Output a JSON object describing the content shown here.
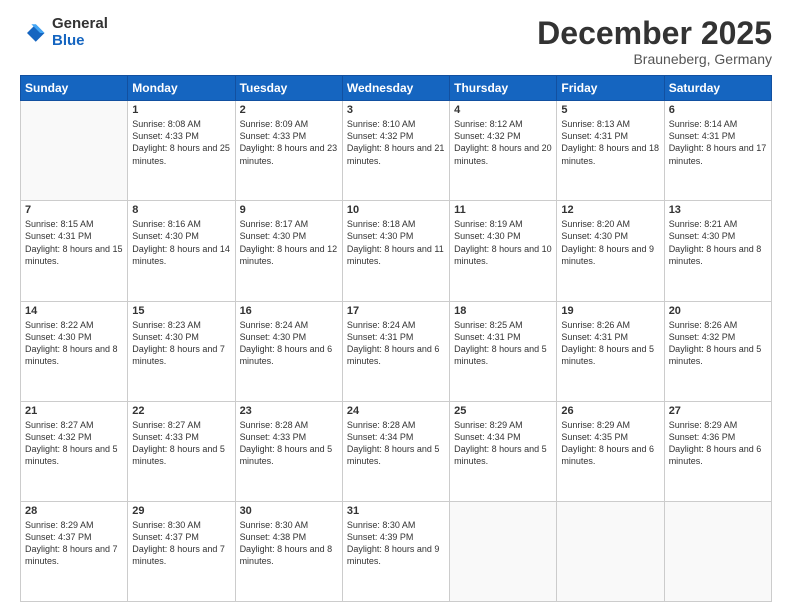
{
  "logo": {
    "general": "General",
    "blue": "Blue"
  },
  "header": {
    "month": "December 2025",
    "location": "Brauneberg, Germany"
  },
  "weekdays": [
    "Sunday",
    "Monday",
    "Tuesday",
    "Wednesday",
    "Thursday",
    "Friday",
    "Saturday"
  ],
  "weeks": [
    [
      {
        "day": "",
        "empty": true
      },
      {
        "day": "1",
        "sunrise": "Sunrise: 8:08 AM",
        "sunset": "Sunset: 4:33 PM",
        "daylight": "Daylight: 8 hours and 25 minutes."
      },
      {
        "day": "2",
        "sunrise": "Sunrise: 8:09 AM",
        "sunset": "Sunset: 4:33 PM",
        "daylight": "Daylight: 8 hours and 23 minutes."
      },
      {
        "day": "3",
        "sunrise": "Sunrise: 8:10 AM",
        "sunset": "Sunset: 4:32 PM",
        "daylight": "Daylight: 8 hours and 21 minutes."
      },
      {
        "day": "4",
        "sunrise": "Sunrise: 8:12 AM",
        "sunset": "Sunset: 4:32 PM",
        "daylight": "Daylight: 8 hours and 20 minutes."
      },
      {
        "day": "5",
        "sunrise": "Sunrise: 8:13 AM",
        "sunset": "Sunset: 4:31 PM",
        "daylight": "Daylight: 8 hours and 18 minutes."
      },
      {
        "day": "6",
        "sunrise": "Sunrise: 8:14 AM",
        "sunset": "Sunset: 4:31 PM",
        "daylight": "Daylight: 8 hours and 17 minutes."
      }
    ],
    [
      {
        "day": "7",
        "sunrise": "Sunrise: 8:15 AM",
        "sunset": "Sunset: 4:31 PM",
        "daylight": "Daylight: 8 hours and 15 minutes."
      },
      {
        "day": "8",
        "sunrise": "Sunrise: 8:16 AM",
        "sunset": "Sunset: 4:30 PM",
        "daylight": "Daylight: 8 hours and 14 minutes."
      },
      {
        "day": "9",
        "sunrise": "Sunrise: 8:17 AM",
        "sunset": "Sunset: 4:30 PM",
        "daylight": "Daylight: 8 hours and 12 minutes."
      },
      {
        "day": "10",
        "sunrise": "Sunrise: 8:18 AM",
        "sunset": "Sunset: 4:30 PM",
        "daylight": "Daylight: 8 hours and 11 minutes."
      },
      {
        "day": "11",
        "sunrise": "Sunrise: 8:19 AM",
        "sunset": "Sunset: 4:30 PM",
        "daylight": "Daylight: 8 hours and 10 minutes."
      },
      {
        "day": "12",
        "sunrise": "Sunrise: 8:20 AM",
        "sunset": "Sunset: 4:30 PM",
        "daylight": "Daylight: 8 hours and 9 minutes."
      },
      {
        "day": "13",
        "sunrise": "Sunrise: 8:21 AM",
        "sunset": "Sunset: 4:30 PM",
        "daylight": "Daylight: 8 hours and 8 minutes."
      }
    ],
    [
      {
        "day": "14",
        "sunrise": "Sunrise: 8:22 AM",
        "sunset": "Sunset: 4:30 PM",
        "daylight": "Daylight: 8 hours and 8 minutes."
      },
      {
        "day": "15",
        "sunrise": "Sunrise: 8:23 AM",
        "sunset": "Sunset: 4:30 PM",
        "daylight": "Daylight: 8 hours and 7 minutes."
      },
      {
        "day": "16",
        "sunrise": "Sunrise: 8:24 AM",
        "sunset": "Sunset: 4:30 PM",
        "daylight": "Daylight: 8 hours and 6 minutes."
      },
      {
        "day": "17",
        "sunrise": "Sunrise: 8:24 AM",
        "sunset": "Sunset: 4:31 PM",
        "daylight": "Daylight: 8 hours and 6 minutes."
      },
      {
        "day": "18",
        "sunrise": "Sunrise: 8:25 AM",
        "sunset": "Sunset: 4:31 PM",
        "daylight": "Daylight: 8 hours and 5 minutes."
      },
      {
        "day": "19",
        "sunrise": "Sunrise: 8:26 AM",
        "sunset": "Sunset: 4:31 PM",
        "daylight": "Daylight: 8 hours and 5 minutes."
      },
      {
        "day": "20",
        "sunrise": "Sunrise: 8:26 AM",
        "sunset": "Sunset: 4:32 PM",
        "daylight": "Daylight: 8 hours and 5 minutes."
      }
    ],
    [
      {
        "day": "21",
        "sunrise": "Sunrise: 8:27 AM",
        "sunset": "Sunset: 4:32 PM",
        "daylight": "Daylight: 8 hours and 5 minutes."
      },
      {
        "day": "22",
        "sunrise": "Sunrise: 8:27 AM",
        "sunset": "Sunset: 4:33 PM",
        "daylight": "Daylight: 8 hours and 5 minutes."
      },
      {
        "day": "23",
        "sunrise": "Sunrise: 8:28 AM",
        "sunset": "Sunset: 4:33 PM",
        "daylight": "Daylight: 8 hours and 5 minutes."
      },
      {
        "day": "24",
        "sunrise": "Sunrise: 8:28 AM",
        "sunset": "Sunset: 4:34 PM",
        "daylight": "Daylight: 8 hours and 5 minutes."
      },
      {
        "day": "25",
        "sunrise": "Sunrise: 8:29 AM",
        "sunset": "Sunset: 4:34 PM",
        "daylight": "Daylight: 8 hours and 5 minutes."
      },
      {
        "day": "26",
        "sunrise": "Sunrise: 8:29 AM",
        "sunset": "Sunset: 4:35 PM",
        "daylight": "Daylight: 8 hours and 6 minutes."
      },
      {
        "day": "27",
        "sunrise": "Sunrise: 8:29 AM",
        "sunset": "Sunset: 4:36 PM",
        "daylight": "Daylight: 8 hours and 6 minutes."
      }
    ],
    [
      {
        "day": "28",
        "sunrise": "Sunrise: 8:29 AM",
        "sunset": "Sunset: 4:37 PM",
        "daylight": "Daylight: 8 hours and 7 minutes."
      },
      {
        "day": "29",
        "sunrise": "Sunrise: 8:30 AM",
        "sunset": "Sunset: 4:37 PM",
        "daylight": "Daylight: 8 hours and 7 minutes."
      },
      {
        "day": "30",
        "sunrise": "Sunrise: 8:30 AM",
        "sunset": "Sunset: 4:38 PM",
        "daylight": "Daylight: 8 hours and 8 minutes."
      },
      {
        "day": "31",
        "sunrise": "Sunrise: 8:30 AM",
        "sunset": "Sunset: 4:39 PM",
        "daylight": "Daylight: 8 hours and 9 minutes."
      },
      {
        "day": "",
        "empty": true
      },
      {
        "day": "",
        "empty": true
      },
      {
        "day": "",
        "empty": true
      }
    ]
  ]
}
